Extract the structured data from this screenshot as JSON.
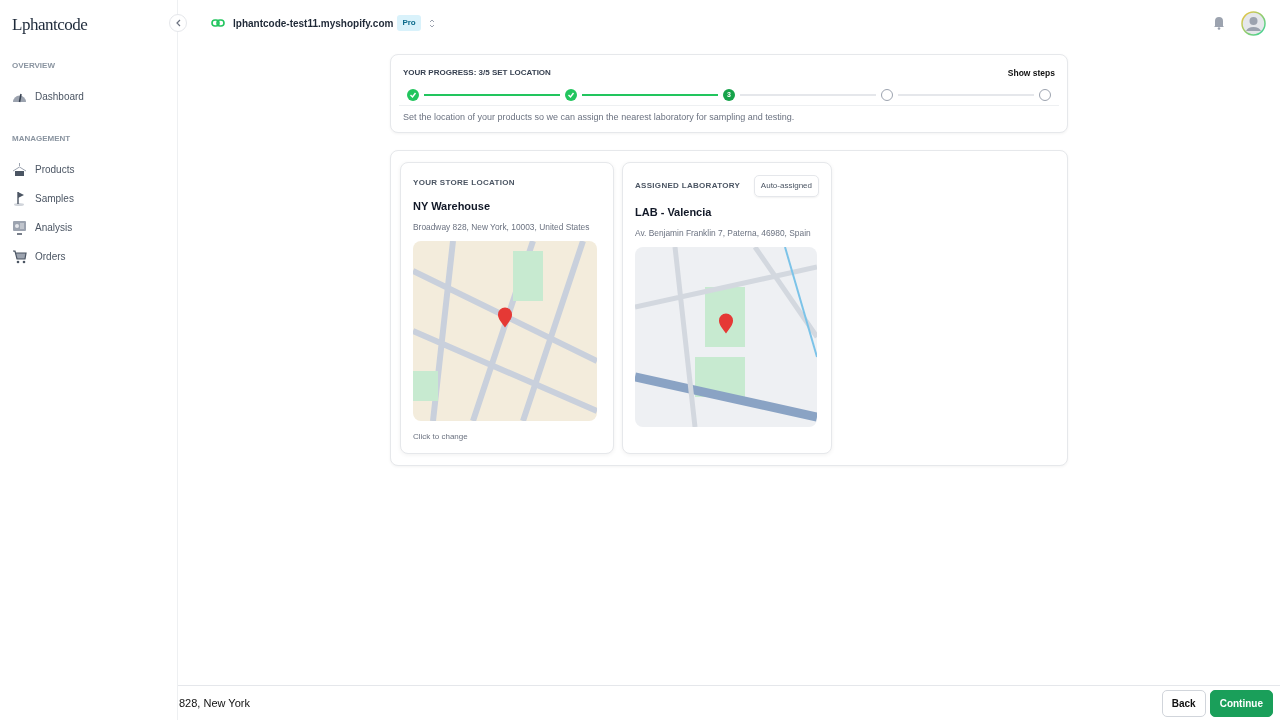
{
  "sidebar": {
    "logo": "Lphantcode",
    "sections": [
      {
        "heading": "OVERVIEW",
        "items": [
          {
            "label": "Dashboard"
          }
        ]
      },
      {
        "heading": "MANAGEMENT",
        "items": [
          {
            "label": "Products"
          },
          {
            "label": "Samples"
          },
          {
            "label": "Analysis"
          },
          {
            "label": "Orders"
          }
        ]
      }
    ]
  },
  "topbar": {
    "store": "lphantcode-test11.myshopify.com",
    "plan": "Pro"
  },
  "progress": {
    "title": "YOUR PROGRESS: 3/5 SET LOCATION",
    "toggle": "Show steps",
    "description": "Set the location of your products so we can assign the nearest laboratory for sampling and testing.",
    "steps": [
      {
        "kind": "done"
      },
      {
        "kind": "done"
      },
      {
        "kind": "current",
        "label": "3"
      },
      {
        "kind": "pending"
      },
      {
        "kind": "pending"
      }
    ]
  },
  "locations": [
    {
      "heading": "YOUR STORE LOCATION",
      "name": "NY Warehouse",
      "address": "Broadway 828, New York, 10003, United States",
      "hint": "Click to change"
    },
    {
      "heading": "ASSIGNED LABORATORY",
      "badge": "Auto-assigned",
      "name": "LAB - Valencia",
      "address": "Av. Benjamin Franklin 7, Paterna, 46980, Spain"
    }
  ],
  "footer": {
    "summary": "828, New York",
    "buttons": [
      {
        "label": "Back",
        "kind": "secondary"
      },
      {
        "label": "Continue",
        "kind": "primary"
      }
    ]
  }
}
